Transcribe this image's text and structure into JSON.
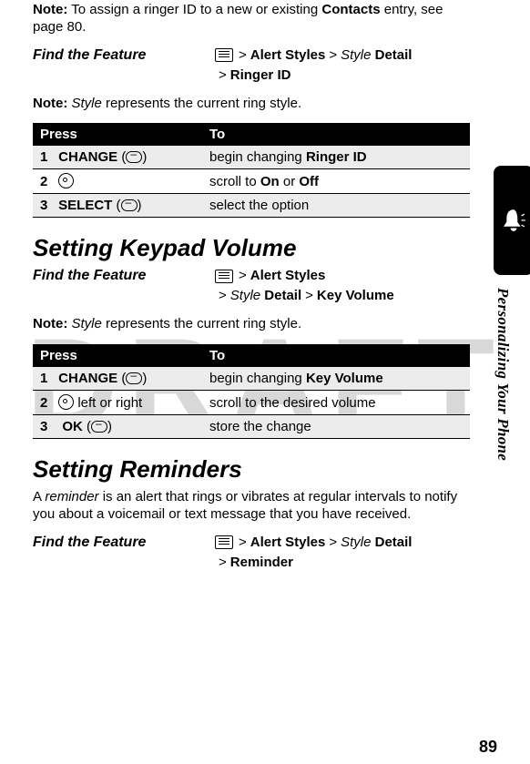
{
  "watermark": "DRAFT",
  "topNote": {
    "label": "Note:",
    "text1": "To assign a ringer ID to a new or existing ",
    "contacts": "Contacts",
    "text2": " entry, see page 80."
  },
  "ftf1": {
    "label": "Find the Feature",
    "line1": {
      "alertStyles": "Alert Styles",
      "styleItalic": "Style",
      "detail": "Detail"
    },
    "line2": {
      "ringerId": "Ringer ID"
    }
  },
  "note2": {
    "label": "Note:",
    "styleItalic": "Style",
    "rest": " represents the current ring style."
  },
  "table1": {
    "head": {
      "press": "Press",
      "to": "To"
    },
    "rows": [
      {
        "num": "1",
        "key": "CHANGE",
        "paren": "(",
        "paren2": ")",
        "to1": "begin changing ",
        "to2": "Ringer ID"
      },
      {
        "num": "2",
        "to1": "scroll to ",
        "on": "On",
        "or": " or ",
        "off": "Off"
      },
      {
        "num": "3",
        "key": "SELECT",
        "paren": "(",
        "paren2": ")",
        "to1": "select the option"
      }
    ]
  },
  "heading2": "Setting Keypad Volume",
  "ftf2": {
    "label": "Find the Feature",
    "line1": {
      "alertStyles": "Alert Styles"
    },
    "line2": {
      "styleItalic": "Style",
      "detail": "Detail",
      "keyVolume": "Key Volume"
    }
  },
  "note3": {
    "label": "Note:",
    "styleItalic": "Style",
    "rest": " represents the current ring style."
  },
  "table2": {
    "head": {
      "press": "Press",
      "to": "To"
    },
    "rows": [
      {
        "num": "1",
        "key": "CHANGE",
        "paren": "(",
        "paren2": ")",
        "to1": "begin changing ",
        "to2": "Key Volume"
      },
      {
        "num": "2",
        "suffix": " left or right",
        "to1": "scroll to the desired volume"
      },
      {
        "num": "3",
        "key": "OK",
        "paren": "(",
        "paren2": ")",
        "to1": "store the change"
      }
    ]
  },
  "heading3": "Setting Reminders",
  "reminderPara": {
    "prefix": "A ",
    "reminderItalic": "reminder",
    "rest": " is an alert that rings or vibrates at regular intervals to notify you about a voicemail or text message that you have received."
  },
  "ftf3": {
    "label": "Find the Feature",
    "line1": {
      "alertStyles": "Alert Styles",
      "styleItalic": "Style",
      "detail": "Detail"
    },
    "line2": {
      "reminder": "Reminder"
    }
  },
  "sideLabel": "Personalizing Your Phone",
  "pageNumber": "89"
}
